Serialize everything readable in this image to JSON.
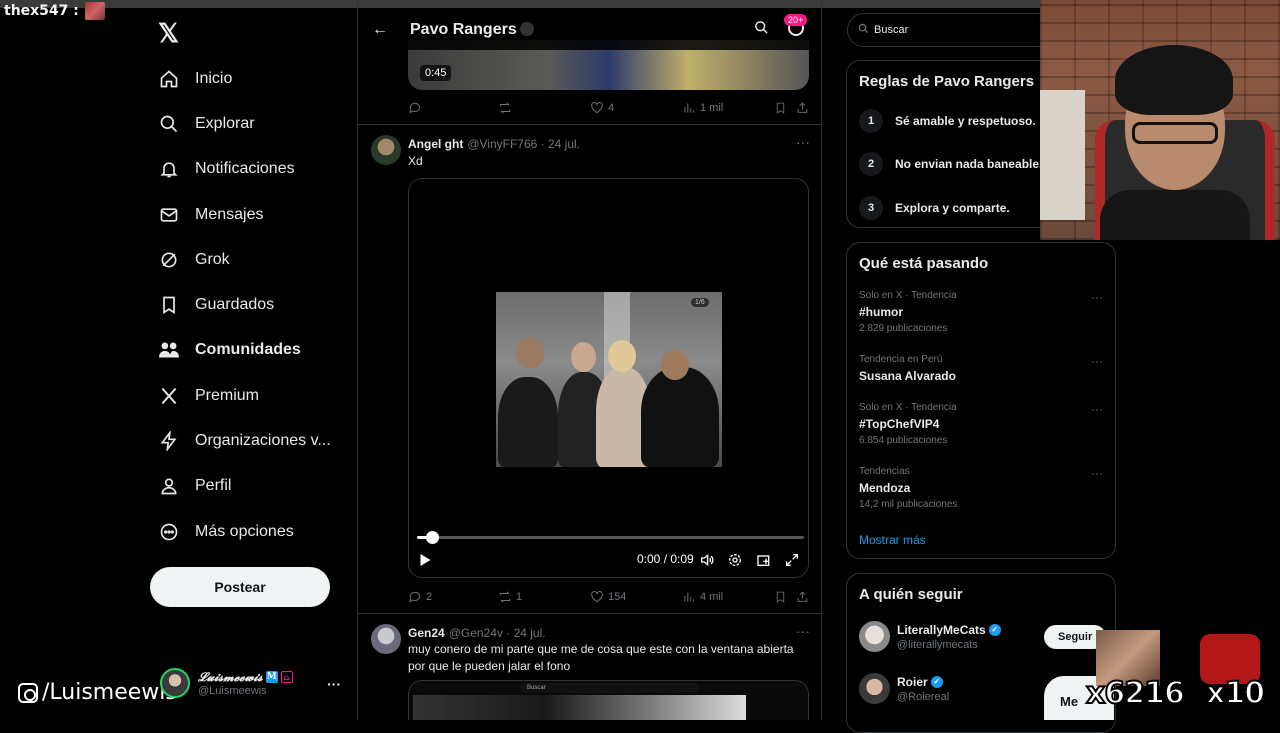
{
  "chat": {
    "user": "thex547 :"
  },
  "sidebar": {
    "items": [
      {
        "label": "Inicio",
        "icon": "home-icon"
      },
      {
        "label": "Explorar",
        "icon": "search-icon"
      },
      {
        "label": "Notificaciones",
        "icon": "bell-icon"
      },
      {
        "label": "Mensajes",
        "icon": "mail-icon"
      },
      {
        "label": "Grok",
        "icon": "grok-icon"
      },
      {
        "label": "Guardados",
        "icon": "bookmark-icon"
      },
      {
        "label": "Comunidades",
        "icon": "communities-icon"
      },
      {
        "label": "Premium",
        "icon": "x-icon"
      },
      {
        "label": "Organizaciones v...",
        "icon": "lightning-icon"
      },
      {
        "label": "Perfil",
        "icon": "person-icon"
      },
      {
        "label": "Más opciones",
        "icon": "more-circle-icon"
      }
    ],
    "post_label": "Postear",
    "account": {
      "name": "𝓛𝓾𝓲𝓼𝓶𝓮𝓮𝔀𝓲𝓼",
      "handle": "@Luismeewis",
      "badge_m": "M",
      "more": "···"
    }
  },
  "overlay_instagram": "/Luismeewis",
  "header": {
    "title": "Pavo Rangers",
    "notif_count": "20+"
  },
  "prev_post": {
    "duration": "0:45",
    "likes": "4",
    "views": "1 mil"
  },
  "tweet1": {
    "name": "Angel ght",
    "handle": "@VinyFF766 · 24 jul.",
    "text": "Xd",
    "photo_count": "1/6",
    "time": "0:00 / 0:09",
    "progress": 0.04,
    "replies": "2",
    "reposts": "1",
    "likes": "154",
    "views": "4 mil"
  },
  "tweet2": {
    "name": "Gen24",
    "handle": "@Gen24v · 24 jul.",
    "text": "muy conero de mi parte que me de cosa que este con la ventana abierta por que le pueden jalar el fono",
    "media_search": "Buscar"
  },
  "search": {
    "placeholder": "Buscar"
  },
  "rules": {
    "title": "Reglas de Pavo Rangers",
    "items": [
      {
        "num": "1",
        "text": "Sé amable y respetuoso."
      },
      {
        "num": "2",
        "text": "No envian nada baneable."
      },
      {
        "num": "3",
        "text": "Explora y comparte."
      }
    ]
  },
  "trends": {
    "title": "Qué está pasando",
    "items": [
      {
        "context": "Solo en X · Tendencia",
        "name": "#humor",
        "count": "2.829 publicaciones"
      },
      {
        "context": "Tendencia en Perú",
        "name": "Susana Alvarado",
        "count": ""
      },
      {
        "context": "Solo en X · Tendencia",
        "name": "#TopChefVIP4",
        "count": "6.854 publicaciones"
      },
      {
        "context": "Tendencias",
        "name": "Mendoza",
        "count": "14,2 mil publicaciones"
      }
    ],
    "show_more": "Mostrar más"
  },
  "who_to_follow": {
    "title": "A quién seguir",
    "items": [
      {
        "name": "LiterallyMeCats",
        "handle": "@literallymecats",
        "button": "Seguir"
      },
      {
        "name": "Roier",
        "handle": "@Roiereal",
        "button": "Me"
      }
    ]
  },
  "combo": {
    "left": "x6216",
    "right": "x10"
  },
  "colors": {
    "accent": "#1d9bf0",
    "bg": "#000000",
    "border": "#2f3336",
    "muted": "#71767b"
  }
}
